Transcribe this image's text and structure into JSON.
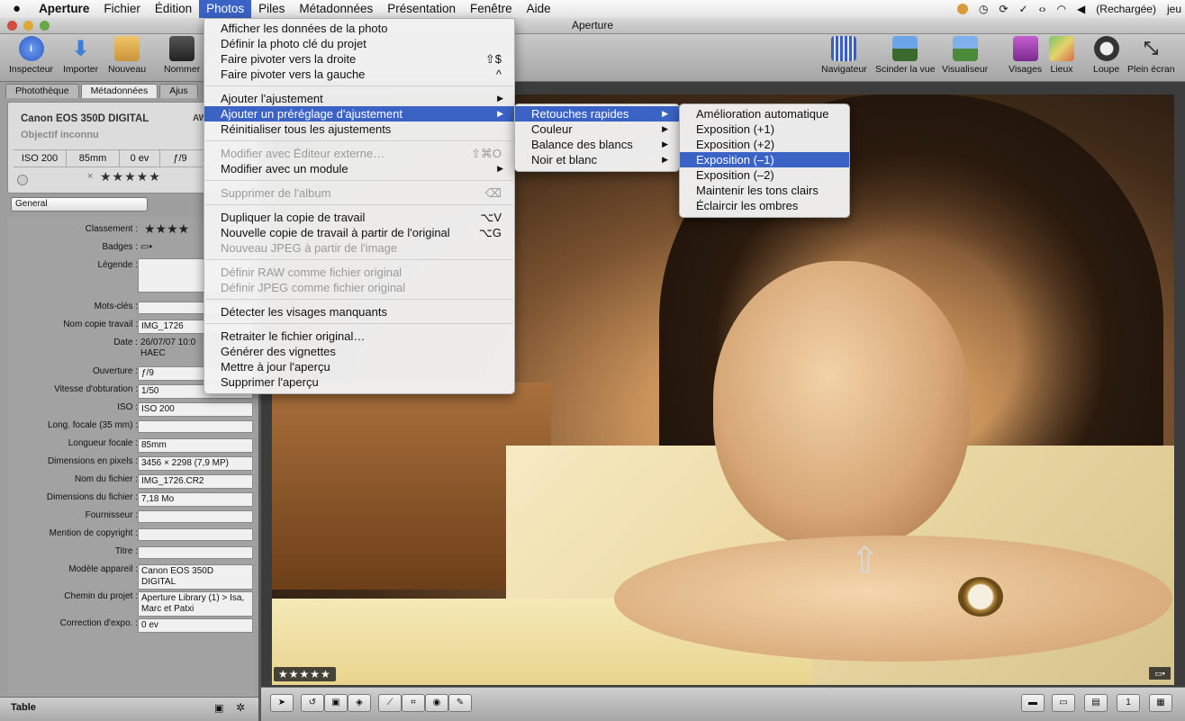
{
  "menubar": {
    "apple": "",
    "app": "Aperture",
    "items": [
      "Fichier",
      "Édition",
      "Photos",
      "Piles",
      "Métadonnées",
      "Présentation",
      "Fenêtre",
      "Aide"
    ],
    "right": {
      "battery": "(Rechargée)",
      "clock": "jeu"
    }
  },
  "window": {
    "title": "Aperture"
  },
  "toolbar": {
    "items": [
      "Inspecteur",
      "Importer",
      "Nouveau",
      "Nommer"
    ],
    "right": [
      "Navigateur",
      "Scinder la vue",
      "Visualiseur",
      "Visages",
      "Lieux",
      "Loupe",
      "Plein écran"
    ]
  },
  "inspector": {
    "tabs": [
      "Photothèque",
      "Métadonnées",
      "Ajus"
    ],
    "camera": {
      "model": "Canon EOS 350D DIGITAL",
      "lens": "Objectif inconnu",
      "awb": "AW",
      "iso": "ISO 200",
      "focal": "85mm",
      "ev": "0 ev",
      "aperture": "ƒ/9",
      "rating": "★★★★★"
    },
    "preset": "General",
    "fields": [
      {
        "label": "Classement :",
        "value": "★★★★"
      },
      {
        "label": "Badges :",
        "value": ""
      },
      {
        "label": "Légende :",
        "value": ""
      },
      {
        "label": "Mots-clés :",
        "value": ""
      },
      {
        "label": "Nom copie travail :",
        "value": "IMG_1726"
      },
      {
        "label": "Date :",
        "value": "26/07/07 10:0"
      },
      {
        "label": "Ouverture :",
        "value": "ƒ/9"
      },
      {
        "label": "Vitesse d'obturation :",
        "value": "1/50"
      },
      {
        "label": "ISO :",
        "value": "ISO 200"
      },
      {
        "label": "Long. focale (35 mm) :",
        "value": ""
      },
      {
        "label": "Longueur focale :",
        "value": "85mm"
      },
      {
        "label": "Dimensions en pixels :",
        "value": "3456 × 2298 (7,9 MP)"
      },
      {
        "label": "Nom du fichier :",
        "value": "IMG_1726.CR2"
      },
      {
        "label": "Dimensions du fichier :",
        "value": "7,18 Mo"
      },
      {
        "label": "Fournisseur :",
        "value": ""
      },
      {
        "label": "Mention de copyright :",
        "value": ""
      },
      {
        "label": "Titre :",
        "value": ""
      },
      {
        "label": "Modèle appareil :",
        "value": "Canon EOS 350D DIGITAL"
      },
      {
        "label": "Chemin du projet :",
        "value": "Aperture Library (1) > Isa, Marc et Patxi"
      },
      {
        "label": "Correction d'expo. :",
        "value": "0 ev"
      }
    ],
    "date_line2": "HAEC",
    "bottom_label": "Table"
  },
  "photo_menu": {
    "items": [
      {
        "label": "Afficher les données de la photo",
        "shortcut": "",
        "disabled": false,
        "submenu": false
      },
      {
        "label": "Définir la photo clé du projet",
        "shortcut": "",
        "disabled": false,
        "submenu": false
      },
      {
        "label": "Faire pivoter vers la droite",
        "shortcut": "⇧$",
        "disabled": false,
        "submenu": false
      },
      {
        "label": "Faire pivoter vers la gauche",
        "shortcut": "^",
        "disabled": false,
        "submenu": false
      },
      {
        "sep": true
      },
      {
        "label": "Ajouter l'ajustement",
        "shortcut": "",
        "disabled": false,
        "submenu": true
      },
      {
        "label": "Ajouter un préréglage d'ajustement",
        "shortcut": "",
        "disabled": false,
        "submenu": true,
        "highlight": true
      },
      {
        "label": "Réinitialiser tous les ajustements",
        "shortcut": "",
        "disabled": false,
        "submenu": false
      },
      {
        "sep": true
      },
      {
        "label": "Modifier avec Éditeur externe…",
        "shortcut": "⇧⌘O",
        "disabled": true,
        "submenu": false
      },
      {
        "label": "Modifier avec un module",
        "shortcut": "",
        "disabled": false,
        "submenu": true
      },
      {
        "sep": true
      },
      {
        "label": "Supprimer de l'album",
        "shortcut": "⌫",
        "disabled": true,
        "submenu": false
      },
      {
        "sep": true
      },
      {
        "label": "Dupliquer la copie de travail",
        "shortcut": "⌥V",
        "disabled": false,
        "submenu": false
      },
      {
        "label": "Nouvelle copie de travail à partir de l'original",
        "shortcut": "⌥G",
        "disabled": false,
        "submenu": false
      },
      {
        "label": "Nouveau JPEG à partir de l'image",
        "shortcut": "",
        "disabled": true,
        "submenu": false
      },
      {
        "sep": true
      },
      {
        "label": "Définir RAW comme fichier original",
        "shortcut": "",
        "disabled": true,
        "submenu": false
      },
      {
        "label": "Définir JPEG comme fichier original",
        "shortcut": "",
        "disabled": true,
        "submenu": false
      },
      {
        "sep": true
      },
      {
        "label": "Détecter les visages manquants",
        "shortcut": "",
        "disabled": false,
        "submenu": false
      },
      {
        "sep": true
      },
      {
        "label": "Retraiter le fichier original…",
        "shortcut": "",
        "disabled": false,
        "submenu": false
      },
      {
        "label": "Générer des vignettes",
        "shortcut": "",
        "disabled": false,
        "submenu": false
      },
      {
        "label": "Mettre à jour l'aperçu",
        "shortcut": "",
        "disabled": false,
        "submenu": false
      },
      {
        "label": "Supprimer l'aperçu",
        "shortcut": "",
        "disabled": false,
        "submenu": false
      }
    ]
  },
  "preset_submenu": {
    "items": [
      {
        "label": "Retouches rapides",
        "highlight": true
      },
      {
        "label": "Couleur",
        "highlight": false
      },
      {
        "label": "Balance des blancs",
        "highlight": false
      },
      {
        "label": "Noir et blanc",
        "highlight": false
      }
    ]
  },
  "quick_submenu": {
    "items": [
      {
        "label": "Amélioration automatique",
        "highlight": false
      },
      {
        "label": "Exposition (+1)",
        "highlight": false
      },
      {
        "label": "Exposition (+2)",
        "highlight": false
      },
      {
        "label": "Exposition (–1)",
        "highlight": true
      },
      {
        "label": "Exposition (–2)",
        "highlight": false
      },
      {
        "label": "Maintenir les tons clairs",
        "highlight": false
      },
      {
        "label": "Éclaircir les ombres",
        "highlight": false
      }
    ]
  },
  "viewer": {
    "rating": "★★★★★"
  }
}
